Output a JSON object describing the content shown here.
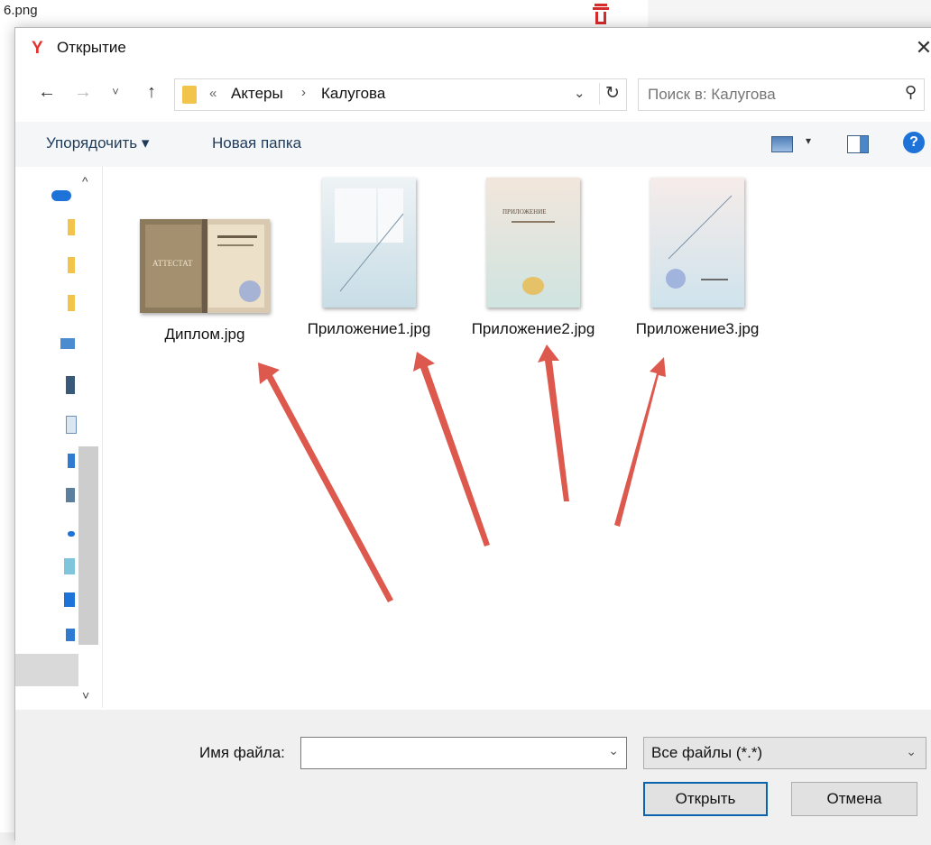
{
  "background": {
    "file_name": "6.png"
  },
  "dialog": {
    "title": "Открытие",
    "logo_glyph": "Y",
    "close_glyph": "✕"
  },
  "address": {
    "more": "«",
    "crumbs": [
      "Актеры",
      "Калугова"
    ],
    "separator": "›",
    "search_placeholder": "Поиск в: Калугова"
  },
  "toolbar": {
    "organize_label": "Упорядочить ▾",
    "new_folder_label": "Новая папка",
    "help_glyph": "?"
  },
  "files": [
    {
      "name": "Диплом.jpg",
      "icon": "diploma-thumbnail"
    },
    {
      "name": "Приложение1.jpg",
      "icon": "appendix-thumbnail"
    },
    {
      "name": "Приложение2.jpg",
      "icon": "appendix-thumbnail"
    },
    {
      "name": "Приложение3.jpg",
      "icon": "appendix-thumbnail"
    }
  ],
  "footer": {
    "filename_label": "Имя файла:",
    "filename_value": "",
    "filetype_value": "Все файлы (*.*)",
    "open_label": "Открыть",
    "cancel_label": "Отмена"
  },
  "colors": {
    "accent": "#0a64ad",
    "arrow": "#d9473b",
    "logo": "#e5312d"
  }
}
